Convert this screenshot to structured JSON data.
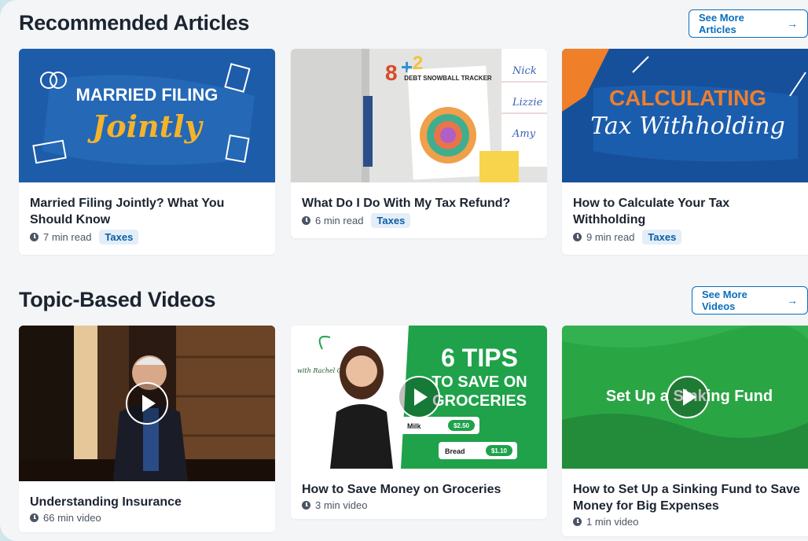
{
  "articles": {
    "heading": "Recommended Articles",
    "see_more": "See More Articles",
    "items": [
      {
        "title": "Married Filing Jointly? What You Should Know",
        "read_time": "7 min read",
        "tag": "Taxes",
        "thumb_line1": "MARRIED FILING",
        "thumb_line2": "Jointly"
      },
      {
        "title": "What Do I Do With My Tax Refund?",
        "read_time": "6 min read",
        "tag": "Taxes",
        "thumb_tracker": "DEBT SNOWBALL TRACKER",
        "thumb_names": [
          "Nick",
          "Lizzie",
          "Amy"
        ]
      },
      {
        "title": "How to Calculate Your Tax Withholding",
        "read_time": "9 min read",
        "tag": "Taxes",
        "thumb_line1": "CALCULATING",
        "thumb_line2": "Tax Withholding"
      }
    ]
  },
  "videos": {
    "heading": "Topic-Based Videos",
    "see_more": "See More Videos",
    "items": [
      {
        "title": "Understanding Insurance",
        "duration": "66 min video"
      },
      {
        "title": "How to Save Money on Groceries",
        "duration": "3 min video",
        "thumb_line1": "6 TIPS",
        "thumb_line2": "TO SAVE ON",
        "thumb_line3": "GROCERIES",
        "thumb_with": "with Rachel Cruze",
        "thumb_milk": "Milk",
        "thumb_milk_price": "$2.50",
        "thumb_bread": "Bread",
        "thumb_bread_price": "$1.10"
      },
      {
        "title": "How to Set Up a Sinking Fund to Save Money for Big Expenses",
        "duration": "1 min video",
        "thumb_text": "Set Up a Sinking Fund"
      }
    ]
  },
  "colors": {
    "accent": "#0a6ebd",
    "panel": "#f4f5f7",
    "backdrop": "#cfe6ec"
  }
}
